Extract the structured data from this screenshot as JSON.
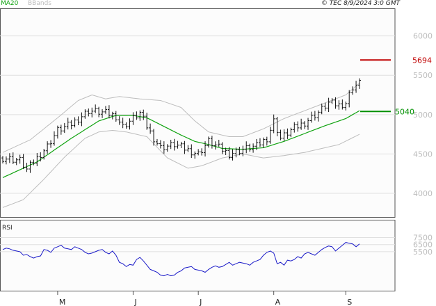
{
  "header": {
    "ma_label": "MA20",
    "bb_label": "BBands",
    "stamp": "© TEC 8/9/2024 3:0 GMT"
  },
  "rsi_label": "RSI",
  "colors": {
    "ma": "#11a311",
    "bands": "#bdbdbd",
    "rsi": "#1a1ac8",
    "resistance": "#c00000",
    "support": "#009000",
    "grid": "#e0e0e0"
  },
  "chart_data": [
    {
      "type": "line",
      "panel": "price",
      "ylim": [
        3700,
        6350
      ],
      "yticks": [
        4000,
        4500,
        5000,
        5500,
        6000
      ],
      "x_labels": [
        {
          "i": 16,
          "label": "M"
        },
        {
          "i": 38,
          "label": "J"
        },
        {
          "i": 57,
          "label": "J"
        },
        {
          "i": 79,
          "label": "A"
        },
        {
          "i": 100,
          "label": "S"
        }
      ],
      "n_bars": 105,
      "close_anchors": [
        [
          0,
          4450
        ],
        [
          5,
          4420
        ],
        [
          7,
          4300
        ],
        [
          10,
          4450
        ],
        [
          13,
          4600
        ],
        [
          16,
          4800
        ],
        [
          20,
          4880
        ],
        [
          25,
          5050
        ],
        [
          30,
          5020
        ],
        [
          33,
          4980
        ],
        [
          35,
          4850
        ],
        [
          38,
          4950
        ],
        [
          40,
          5020
        ],
        [
          42,
          4850
        ],
        [
          44,
          4700
        ],
        [
          46,
          4580
        ],
        [
          50,
          4620
        ],
        [
          54,
          4550
        ],
        [
          57,
          4500
        ],
        [
          60,
          4660
        ],
        [
          63,
          4580
        ],
        [
          66,
          4500
        ],
        [
          70,
          4560
        ],
        [
          74,
          4600
        ],
        [
          77,
          4700
        ],
        [
          79,
          4920
        ],
        [
          81,
          4700
        ],
        [
          84,
          4800
        ],
        [
          88,
          4900
        ],
        [
          92,
          5030
        ],
        [
          95,
          5150
        ],
        [
          98,
          5120
        ],
        [
          100,
          5150
        ],
        [
          102,
          5350
        ],
        [
          104,
          5400
        ]
      ],
      "ma20_anchors": [
        [
          0,
          4200
        ],
        [
          10,
          4400
        ],
        [
          20,
          4700
        ],
        [
          28,
          4920
        ],
        [
          33,
          4990
        ],
        [
          38,
          4990
        ],
        [
          42,
          4960
        ],
        [
          47,
          4850
        ],
        [
          52,
          4740
        ],
        [
          56,
          4660
        ],
        [
          60,
          4620
        ],
        [
          64,
          4570
        ],
        [
          70,
          4560
        ],
        [
          76,
          4580
        ],
        [
          82,
          4660
        ],
        [
          88,
          4760
        ],
        [
          94,
          4860
        ],
        [
          100,
          4950
        ],
        [
          104,
          5050
        ]
      ],
      "bb_upper_anchors": [
        [
          0,
          4520
        ],
        [
          8,
          4680
        ],
        [
          16,
          4960
        ],
        [
          22,
          5180
        ],
        [
          26,
          5250
        ],
        [
          30,
          5200
        ],
        [
          34,
          5230
        ],
        [
          40,
          5200
        ],
        [
          46,
          5180
        ],
        [
          52,
          5090
        ],
        [
          56,
          4920
        ],
        [
          60,
          4780
        ],
        [
          66,
          4720
        ],
        [
          70,
          4720
        ],
        [
          76,
          4820
        ],
        [
          82,
          4950
        ],
        [
          88,
          5050
        ],
        [
          94,
          5150
        ],
        [
          100,
          5250
        ],
        [
          104,
          5400
        ]
      ],
      "bb_lower_anchors": [
        [
          0,
          3820
        ],
        [
          6,
          3920
        ],
        [
          12,
          4180
        ],
        [
          18,
          4460
        ],
        [
          24,
          4700
        ],
        [
          28,
          4780
        ],
        [
          32,
          4800
        ],
        [
          36,
          4780
        ],
        [
          42,
          4720
        ],
        [
          48,
          4450
        ],
        [
          54,
          4320
        ],
        [
          58,
          4350
        ],
        [
          64,
          4450
        ],
        [
          70,
          4500
        ],
        [
          76,
          4450
        ],
        [
          82,
          4480
        ],
        [
          88,
          4520
        ],
        [
          94,
          4580
        ],
        [
          98,
          4620
        ],
        [
          104,
          4750
        ]
      ],
      "levels": [
        {
          "value": 5694,
          "label": "5694",
          "role": "resistance"
        },
        {
          "value": 5040,
          "label": "5040",
          "role": "support"
        }
      ]
    },
    {
      "type": "line",
      "panel": "rsi",
      "ylim": [
        0,
        100
      ],
      "ticks": [
        {
          "value": 75,
          "label": "7500"
        },
        {
          "value": 65,
          "label": "6500"
        },
        {
          "value": 55,
          "label": "5500"
        }
      ],
      "series": [
        {
          "values": [
            58,
            60,
            59,
            57,
            56,
            55,
            50,
            51,
            48,
            46,
            48,
            49,
            58,
            57,
            54,
            60,
            62,
            64,
            60,
            59,
            58,
            62,
            60,
            58,
            54,
            52,
            53,
            55,
            57,
            58,
            54,
            52,
            56,
            50,
            40,
            38,
            34,
            37,
            36,
            44,
            47,
            42,
            36,
            30,
            28,
            26,
            22,
            21,
            23,
            21,
            22,
            26,
            28,
            32,
            33,
            34,
            30,
            29,
            28,
            26,
            30,
            33,
            35,
            33,
            34,
            37,
            40,
            36,
            38,
            40,
            39,
            38,
            36,
            40,
            42,
            44,
            50,
            54,
            56,
            53,
            38,
            40,
            36,
            43,
            42,
            44,
            48,
            46,
            52,
            54,
            52,
            50,
            54,
            58,
            61,
            63,
            62,
            56,
            60,
            64,
            68,
            67,
            66,
            62,
            66
          ]
        }
      ]
    }
  ]
}
